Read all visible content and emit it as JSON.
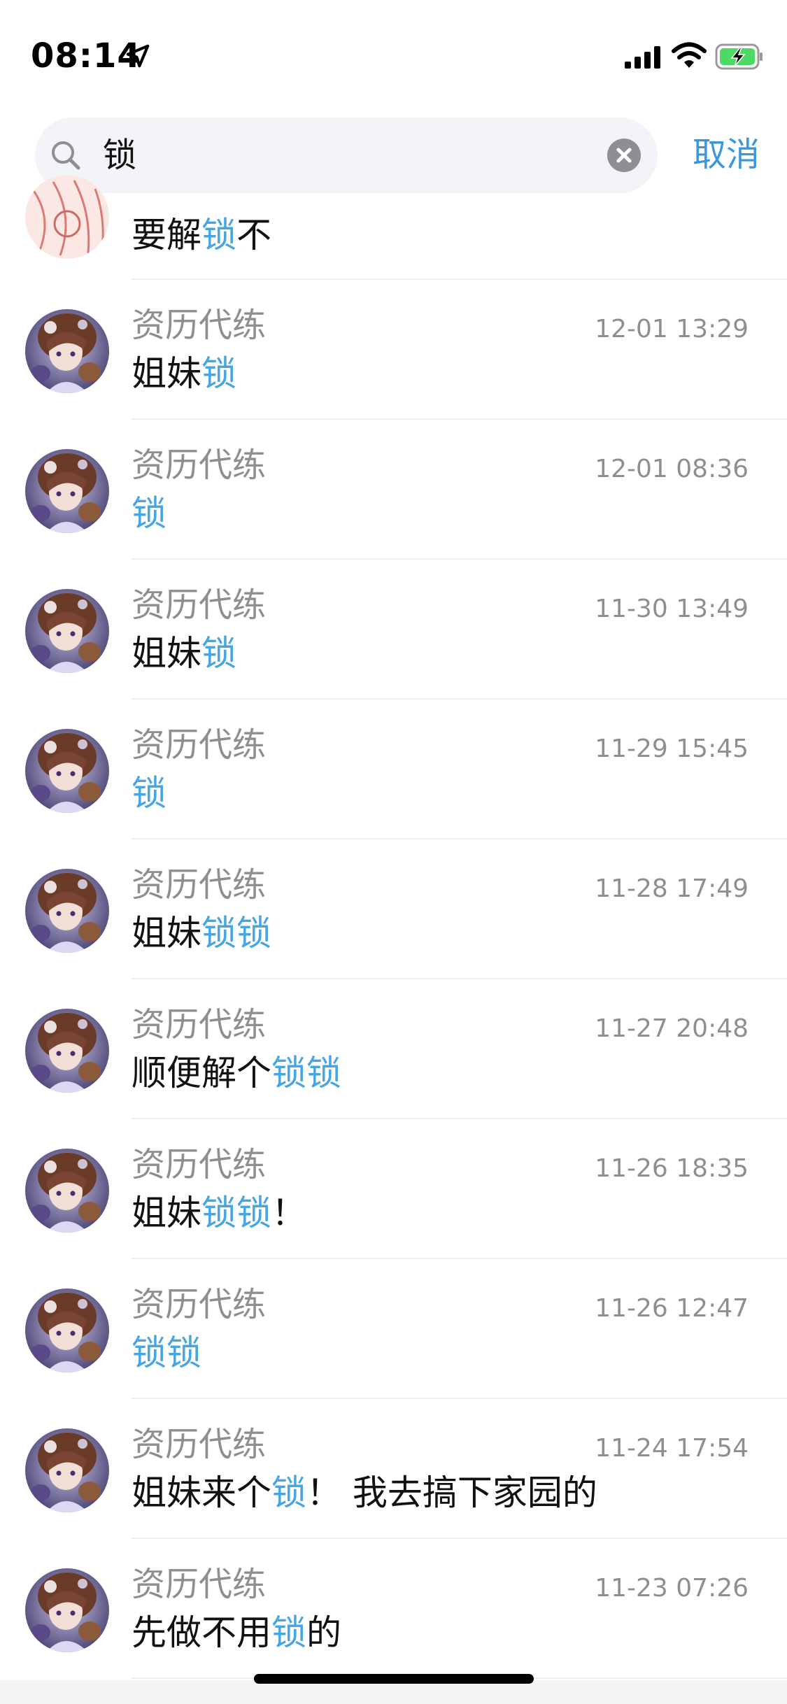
{
  "status_bar": {
    "time": "08:14",
    "icons": [
      "location-arrow-icon",
      "signal-icon",
      "wifi-icon",
      "battery-charging-icon"
    ]
  },
  "search": {
    "query": "锁",
    "cancel_label": "取消"
  },
  "colors": {
    "accent": "#3d96d8",
    "highlight": "#47a6e1",
    "secondary_text": "#8e8e93",
    "search_bg": "#f3f4f8",
    "divider": "#ececec"
  },
  "results": [
    {
      "name": "",
      "time": "",
      "message": [
        {
          "t": "要解",
          "h": false
        },
        {
          "t": "锁",
          "h": true
        },
        {
          "t": "不",
          "h": false
        }
      ]
    },
    {
      "name": "资历代练",
      "time": "12-01 13:29",
      "message": [
        {
          "t": "姐妹",
          "h": false
        },
        {
          "t": "锁",
          "h": true
        }
      ]
    },
    {
      "name": "资历代练",
      "time": "12-01 08:36",
      "message": [
        {
          "t": "锁",
          "h": true
        }
      ]
    },
    {
      "name": "资历代练",
      "time": "11-30 13:49",
      "message": [
        {
          "t": "姐妹",
          "h": false
        },
        {
          "t": "锁",
          "h": true
        }
      ]
    },
    {
      "name": "资历代练",
      "time": "11-29 15:45",
      "message": [
        {
          "t": "锁",
          "h": true
        }
      ]
    },
    {
      "name": "资历代练",
      "time": "11-28 17:49",
      "message": [
        {
          "t": "姐妹",
          "h": false
        },
        {
          "t": "锁锁",
          "h": true
        }
      ]
    },
    {
      "name": "资历代练",
      "time": "11-27 20:48",
      "message": [
        {
          "t": "顺便解个",
          "h": false
        },
        {
          "t": "锁锁",
          "h": true
        }
      ]
    },
    {
      "name": "资历代练",
      "time": "11-26 18:35",
      "message": [
        {
          "t": "姐妹",
          "h": false
        },
        {
          "t": "锁锁",
          "h": true
        },
        {
          "t": "！",
          "h": false
        }
      ]
    },
    {
      "name": "资历代练",
      "time": "11-26 12:47",
      "message": [
        {
          "t": "锁锁",
          "h": true
        }
      ]
    },
    {
      "name": "资历代练",
      "time": "11-24 17:54",
      "message": [
        {
          "t": "姐妹来个",
          "h": false
        },
        {
          "t": "锁",
          "h": true
        },
        {
          "t": "！ 我去搞下家园的",
          "h": false
        }
      ]
    },
    {
      "name": "资历代练",
      "time": "11-23 07:26",
      "message": [
        {
          "t": "先做不用",
          "h": false
        },
        {
          "t": "锁",
          "h": true
        },
        {
          "t": "的",
          "h": false
        }
      ]
    }
  ]
}
